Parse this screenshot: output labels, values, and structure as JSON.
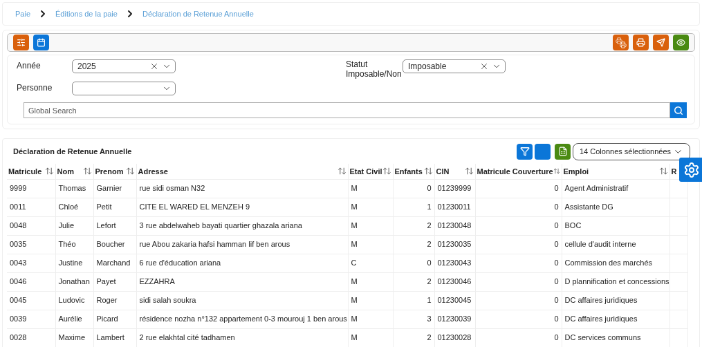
{
  "breadcrumb": [
    "Paie",
    "Éditions de la paie",
    "Déclaration de Retenue Annuelle"
  ],
  "toolbar": {
    "left": [
      {
        "kind": "sliders",
        "color": "#d9600c"
      },
      {
        "kind": "calendar",
        "color": "#0b76d8"
      }
    ],
    "right": [
      {
        "kind": "printers",
        "color": "#d9600c"
      },
      {
        "kind": "print",
        "color": "#d9600c"
      },
      {
        "kind": "send",
        "color": "#d9600c"
      },
      {
        "kind": "eye",
        "color": "#4a8a12"
      }
    ]
  },
  "filters": {
    "annee": {
      "label": "Année",
      "value": "2025"
    },
    "statut": {
      "label": "Statut Imposable/Non",
      "value": "Imposable"
    },
    "personne": {
      "label": "Personne"
    },
    "search": {
      "placeholder": "Global Search"
    }
  },
  "table": {
    "title": "Déclaration de Retenue Annuelle",
    "columns_select": "14 Colonnes sélectionnées",
    "columns": [
      {
        "label": "Matricule",
        "kind": "text"
      },
      {
        "label": "Nom",
        "kind": "text"
      },
      {
        "label": "Prenom",
        "kind": "text"
      },
      {
        "label": "Adresse",
        "kind": "text"
      },
      {
        "label": "Etat Civil",
        "kind": "text"
      },
      {
        "label": "Enfants",
        "kind": "number"
      },
      {
        "label": "CIN",
        "kind": "text"
      },
      {
        "label": "Matricule Couverture",
        "kind": "number"
      },
      {
        "label": "Emploi",
        "kind": "text"
      },
      {
        "label": "R",
        "kind": "text"
      }
    ],
    "rows": [
      [
        "9999",
        "Thomas",
        "Garnier",
        "rue sidi osman N32",
        "M",
        "0",
        "01239999",
        "0",
        "Agent Administratif"
      ],
      [
        "0011",
        "Chloé",
        "Petit",
        "CITE EL WARED EL MENZEH 9",
        "M",
        "1",
        "01230011",
        "0",
        "Assistante DG"
      ],
      [
        "0048",
        "Julie",
        "Lefort",
        "3 rue abdelwaheb bayati quartier ghazala ariana",
        "M",
        "2",
        "01230048",
        "0",
        "BOC"
      ],
      [
        "0035",
        "Théo",
        "Boucher",
        "rue Abou zakaria hafsi hamman lif ben arous",
        "M",
        "2",
        "01230035",
        "0",
        "cellule d'audit interne"
      ],
      [
        "0043",
        "Justine",
        "Marchand",
        "6 rue d'éducation ariana",
        "C",
        "0",
        "01230043",
        "0",
        "Commission des marchés"
      ],
      [
        "0046",
        "Jonathan",
        "Payet",
        "EZZAHRA",
        "M",
        "2",
        "01230046",
        "0",
        "D plannification et concessions"
      ],
      [
        "0045",
        "Ludovic",
        "Roger",
        "sidi salah soukra",
        "M",
        "1",
        "01230045",
        "0",
        "DC affaires juridiques"
      ],
      [
        "0039",
        "Aurélie",
        "Picard",
        "résidence nozha n°132 appartement 0-3 mourouj 1 ben arous",
        "M",
        "3",
        "01230039",
        "0",
        "DC affaires juridiques"
      ],
      [
        "0028",
        "Maxime",
        "Lambert",
        "2 rue elakhtal cité tadhamen",
        "M",
        "2",
        "01230028",
        "0",
        "DC services communs"
      ],
      []
    ]
  }
}
